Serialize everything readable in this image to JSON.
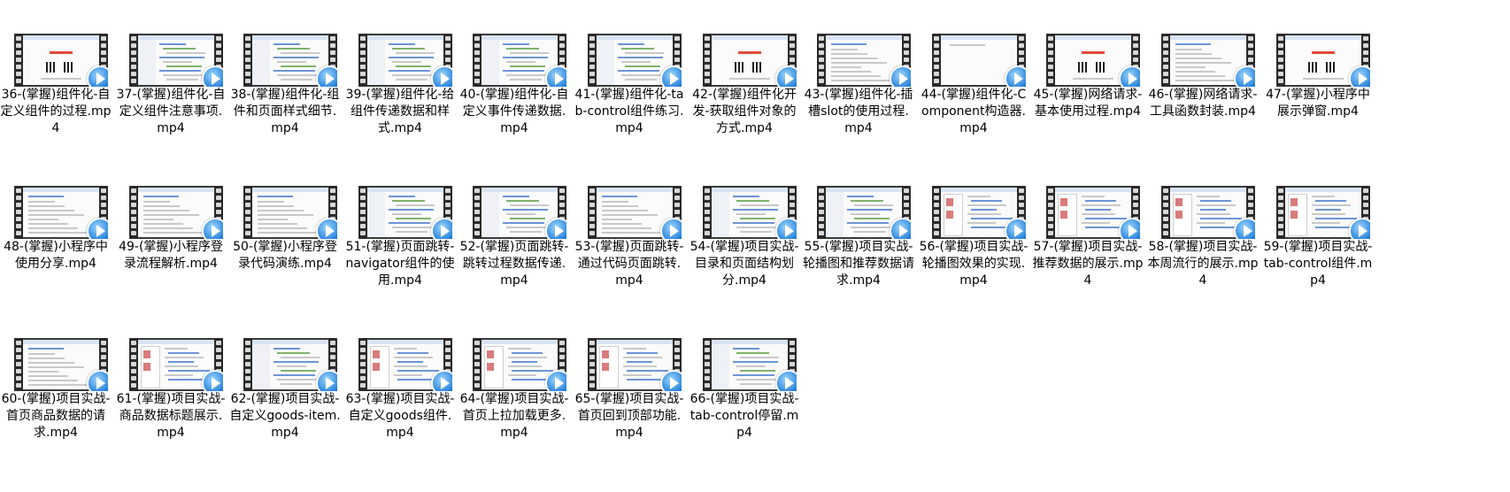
{
  "window": {
    "view": "file-thumbnails"
  },
  "items": [
    {
      "name": "36-(掌握)组件化-自定义组件的过程.mp4",
      "icon": "video-file-icon",
      "thumb": "slide-red"
    },
    {
      "name": "37-(掌握)组件化-自定义组件注意事项.mp4",
      "icon": "video-file-icon",
      "thumb": "code"
    },
    {
      "name": "38-(掌握)组件化-组件和页面样式细节.mp4",
      "icon": "video-file-icon",
      "thumb": "code"
    },
    {
      "name": "39-(掌握)组件化-给组件传递数据和样式.mp4",
      "icon": "video-file-icon",
      "thumb": "code"
    },
    {
      "name": "40-(掌握)组件化-自定义事件传递数据.mp4",
      "icon": "video-file-icon",
      "thumb": "code"
    },
    {
      "name": "41-(掌握)组件化-tab-control组件练习.mp4",
      "icon": "video-file-icon",
      "thumb": "code"
    },
    {
      "name": "42-(掌握)组件化开发-获取组件对象的方式.mp4",
      "icon": "video-file-icon",
      "thumb": "slide-red"
    },
    {
      "name": "43-(掌握)组件化-插槽slot的使用过程.mp4",
      "icon": "video-file-icon",
      "thumb": "doc"
    },
    {
      "name": "44-(掌握)组件化-Component构造器.mp4",
      "icon": "video-file-icon",
      "thumb": "blank"
    },
    {
      "name": "45-(掌握)网络请求-基本使用过程.mp4",
      "icon": "video-file-icon",
      "thumb": "slide-red"
    },
    {
      "name": "46-(掌握)网络请求-工具函数封装.mp4",
      "icon": "video-file-icon",
      "thumb": "doc"
    },
    {
      "name": "47-(掌握)小程序中展示弹窗.mp4",
      "icon": "video-file-icon",
      "thumb": "slide-red"
    },
    {
      "name": "48-(掌握)小程序中使用分享.mp4",
      "icon": "video-file-icon",
      "thumb": "doc"
    },
    {
      "name": "49-(掌握)小程序登录流程解析.mp4",
      "icon": "video-file-icon",
      "thumb": "doc"
    },
    {
      "name": "50-(掌握)小程序登录代码演练.mp4",
      "icon": "video-file-icon",
      "thumb": "doc"
    },
    {
      "name": "51-(掌握)页面跳转-navigator组件的使用.mp4",
      "icon": "video-file-icon",
      "thumb": "code"
    },
    {
      "name": "52-(掌握)页面跳转-跳转过程数据传递.mp4",
      "icon": "video-file-icon",
      "thumb": "code"
    },
    {
      "name": "53-(掌握)页面跳转-通过代码页面跳转.mp4",
      "icon": "video-file-icon",
      "thumb": "doc"
    },
    {
      "name": "54-(掌握)项目实战-目录和页面结构划分.mp4",
      "icon": "video-file-icon",
      "thumb": "code"
    },
    {
      "name": "55-(掌握)项目实战-轮播图和推荐数据请求.mp4",
      "icon": "video-file-icon",
      "thumb": "code"
    },
    {
      "name": "56-(掌握)项目实战-轮播图效果的实现.mp4",
      "icon": "video-file-icon",
      "thumb": "app"
    },
    {
      "name": "57-(掌握)项目实战-推荐数据的展示.mp4",
      "icon": "video-file-icon",
      "thumb": "app"
    },
    {
      "name": "58-(掌握)项目实战-本周流行的展示.mp4",
      "icon": "video-file-icon",
      "thumb": "app"
    },
    {
      "name": "59-(掌握)项目实战-tab-control组件.mp4",
      "icon": "video-file-icon",
      "thumb": "app"
    },
    {
      "name": "60-(掌握)项目实战-首页商品数据的请求.mp4",
      "icon": "video-file-icon",
      "thumb": "doc"
    },
    {
      "name": "61-(掌握)项目实战-商品数据标题展示.mp4",
      "icon": "video-file-icon",
      "thumb": "app"
    },
    {
      "name": "62-(掌握)项目实战-自定义goods-item.mp4",
      "icon": "video-file-icon",
      "thumb": "code"
    },
    {
      "name": "63-(掌握)项目实战-自定义goods组件.mp4",
      "icon": "video-file-icon",
      "thumb": "app"
    },
    {
      "name": "64-(掌握)项目实战-首页上拉加载更多.mp4",
      "icon": "video-file-icon",
      "thumb": "app"
    },
    {
      "name": "65-(掌握)项目实战-首页回到顶部功能.mp4",
      "icon": "video-file-icon",
      "thumb": "app"
    },
    {
      "name": "66-(掌握)项目实战-tab-control停留.mp4",
      "icon": "video-file-icon",
      "thumb": "code"
    }
  ]
}
